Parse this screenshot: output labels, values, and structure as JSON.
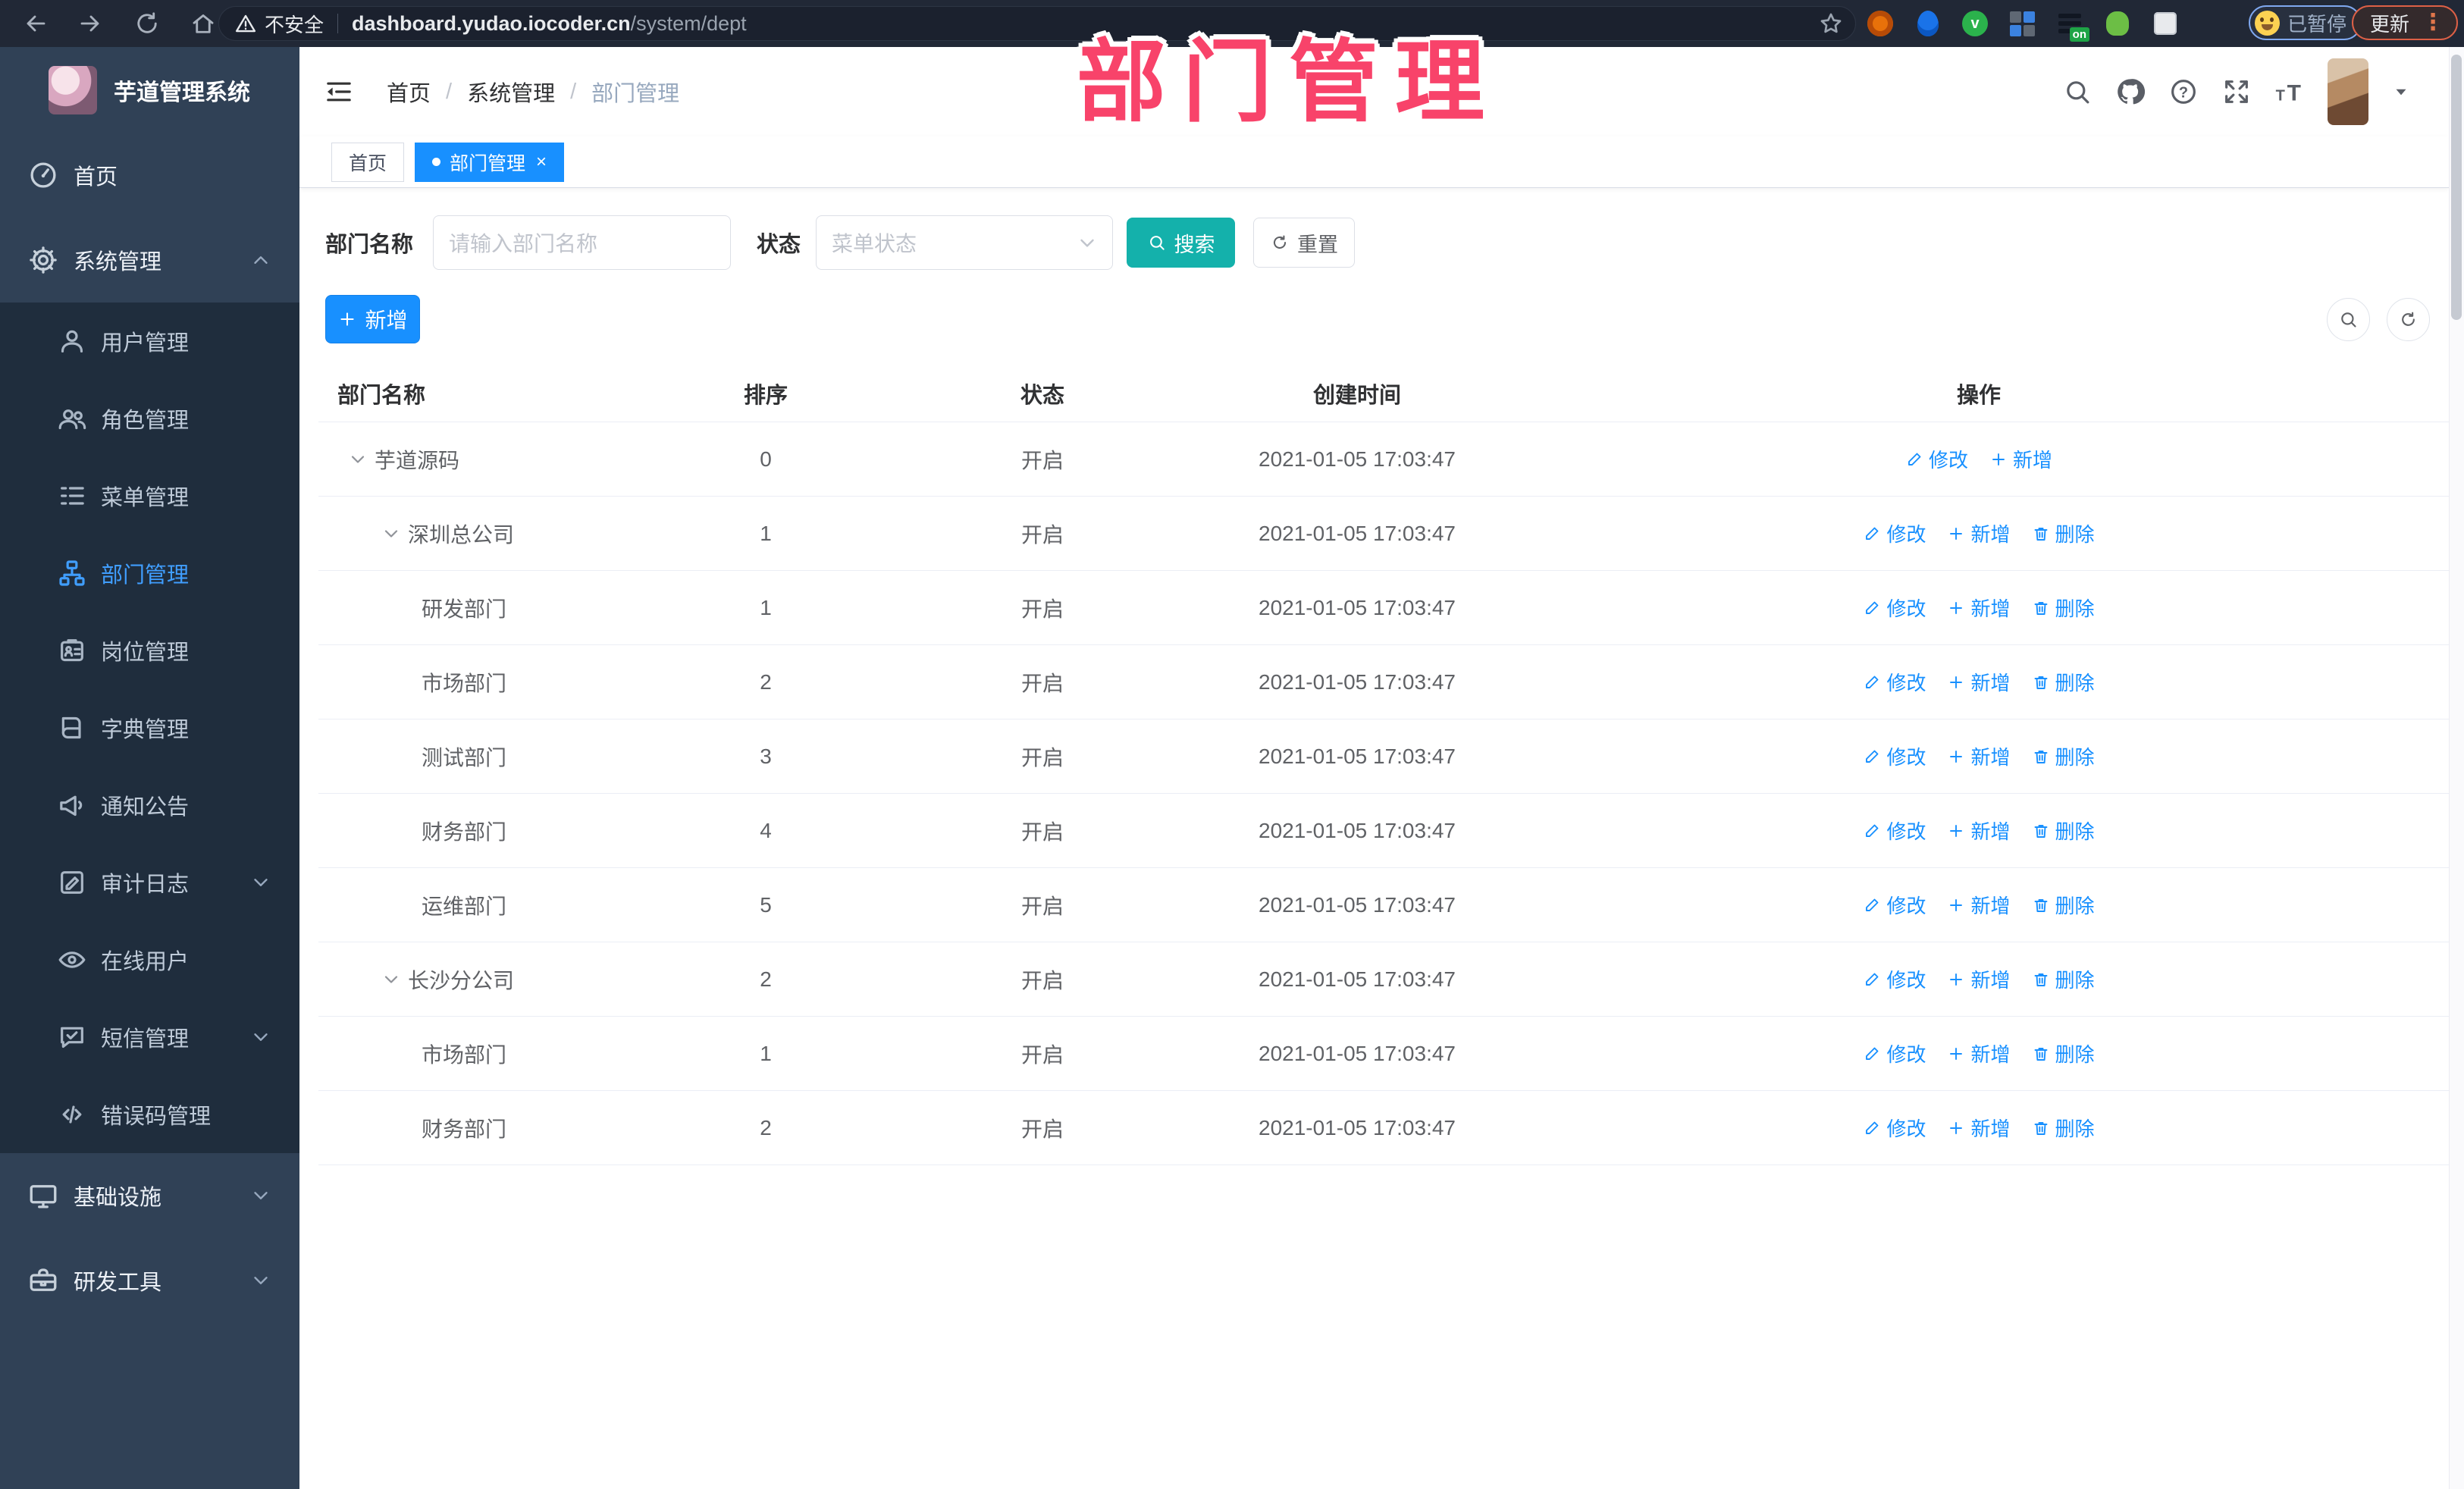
{
  "colors": {
    "primary": "#1890ff",
    "teal": "#14b1ab",
    "annotation": "#f8436a",
    "sidebar-bg": "#304156",
    "submenu-bg": "#1f2d3d",
    "sidebar-active": "#409eff"
  },
  "browser": {
    "security_label": "不安全",
    "url_domain": "dashboard.yudao.iocoder.cn",
    "url_path": "/system/dept",
    "extension_badge": "on",
    "profile_label": "已暂停",
    "update_label": "更新"
  },
  "annotation": {
    "text": "部门管理"
  },
  "app": {
    "title": "芋道管理系统"
  },
  "breadcrumb": {
    "items": [
      "首页",
      "系统管理",
      "部门管理"
    ]
  },
  "tabs": [
    {
      "label": "首页",
      "active": false
    },
    {
      "label": "部门管理",
      "active": true,
      "closable": true
    }
  ],
  "sidebar": {
    "items": [
      {
        "label": "首页",
        "icon": "dashboard",
        "level": "top"
      },
      {
        "label": "系统管理",
        "icon": "gear",
        "level": "top",
        "chevron": "up"
      },
      {
        "label": "用户管理",
        "icon": "user",
        "level": "sub"
      },
      {
        "label": "角色管理",
        "icon": "users",
        "level": "sub"
      },
      {
        "label": "菜单管理",
        "icon": "menu-list",
        "level": "sub"
      },
      {
        "label": "部门管理",
        "icon": "org-tree",
        "level": "sub",
        "active": true
      },
      {
        "label": "岗位管理",
        "icon": "id-badge",
        "level": "sub"
      },
      {
        "label": "字典管理",
        "icon": "book",
        "level": "sub"
      },
      {
        "label": "通知公告",
        "icon": "megaphone",
        "level": "sub"
      },
      {
        "label": "审计日志",
        "icon": "edit-log",
        "level": "sub",
        "chevron": "down"
      },
      {
        "label": "在线用户",
        "icon": "online",
        "level": "sub"
      },
      {
        "label": "短信管理",
        "icon": "sms",
        "level": "sub",
        "chevron": "down"
      },
      {
        "label": "错误码管理",
        "icon": "code",
        "level": "sub"
      },
      {
        "label": "基础设施",
        "icon": "monitor",
        "level": "top",
        "chevron": "down"
      },
      {
        "label": "研发工具",
        "icon": "toolbox",
        "level": "top",
        "chevron": "down"
      }
    ]
  },
  "filters": {
    "name_label": "部门名称",
    "name_placeholder": "请输入部门名称",
    "status_label": "状态",
    "status_placeholder": "菜单状态",
    "search_label": "搜索",
    "reset_label": "重置"
  },
  "toolbar": {
    "add_label": "新增"
  },
  "actions": {
    "edit": "修改",
    "add": "新增",
    "delete": "删除"
  },
  "table": {
    "headers": [
      "部门名称",
      "排序",
      "状态",
      "创建时间",
      "操作"
    ],
    "rows": [
      {
        "name": "芋道源码",
        "level": 0,
        "expandable": true,
        "sort": "0",
        "status": "开启",
        "created": "2021-01-05 17:03:47",
        "actions": [
          "edit",
          "add"
        ]
      },
      {
        "name": "深圳总公司",
        "level": 1,
        "expandable": true,
        "sort": "1",
        "status": "开启",
        "created": "2021-01-05 17:03:47",
        "actions": [
          "edit",
          "add",
          "delete"
        ]
      },
      {
        "name": "研发部门",
        "level": 2,
        "expandable": false,
        "sort": "1",
        "status": "开启",
        "created": "2021-01-05 17:03:47",
        "actions": [
          "edit",
          "add",
          "delete"
        ]
      },
      {
        "name": "市场部门",
        "level": 2,
        "expandable": false,
        "sort": "2",
        "status": "开启",
        "created": "2021-01-05 17:03:47",
        "actions": [
          "edit",
          "add",
          "delete"
        ]
      },
      {
        "name": "测试部门",
        "level": 2,
        "expandable": false,
        "sort": "3",
        "status": "开启",
        "created": "2021-01-05 17:03:47",
        "actions": [
          "edit",
          "add",
          "delete"
        ]
      },
      {
        "name": "财务部门",
        "level": 2,
        "expandable": false,
        "sort": "4",
        "status": "开启",
        "created": "2021-01-05 17:03:47",
        "actions": [
          "edit",
          "add",
          "delete"
        ]
      },
      {
        "name": "运维部门",
        "level": 2,
        "expandable": false,
        "sort": "5",
        "status": "开启",
        "created": "2021-01-05 17:03:47",
        "actions": [
          "edit",
          "add",
          "delete"
        ]
      },
      {
        "name": "长沙分公司",
        "level": 1,
        "expandable": true,
        "sort": "2",
        "status": "开启",
        "created": "2021-01-05 17:03:47",
        "actions": [
          "edit",
          "add",
          "delete"
        ]
      },
      {
        "name": "市场部门",
        "level": 2,
        "expandable": false,
        "sort": "1",
        "status": "开启",
        "created": "2021-01-05 17:03:47",
        "actions": [
          "edit",
          "add",
          "delete"
        ]
      },
      {
        "name": "财务部门",
        "level": 2,
        "expandable": false,
        "sort": "2",
        "status": "开启",
        "created": "2021-01-05 17:03:47",
        "actions": [
          "edit",
          "add",
          "delete"
        ]
      }
    ]
  }
}
